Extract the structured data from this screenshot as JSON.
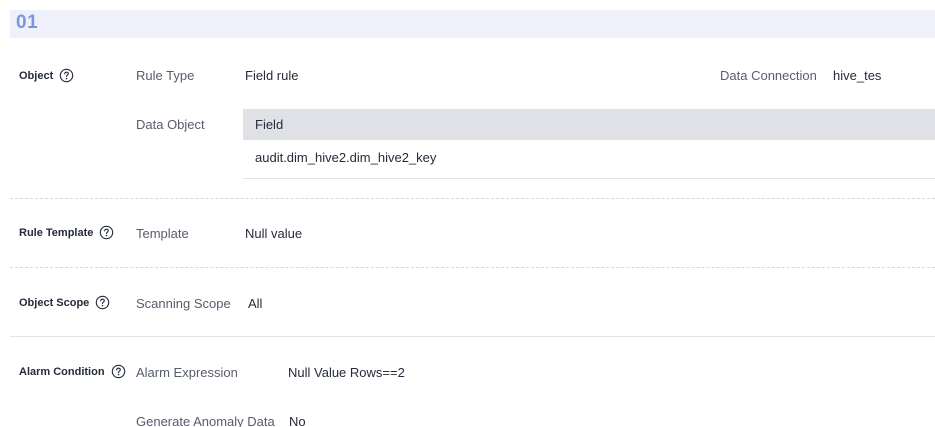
{
  "section": {
    "number": "01"
  },
  "object": {
    "label": "Object",
    "rule_type_label": "Rule Type",
    "rule_type_value": "Field rule",
    "data_connection_label": "Data Connection",
    "data_connection_value": "hive_tes",
    "data_object_label": "Data Object",
    "table": {
      "header": "Field",
      "rows": [
        "audit.dim_hive2.dim_hive2_key"
      ]
    }
  },
  "rule_template": {
    "label": "Rule Template",
    "template_label": "Template",
    "template_value": "Null value"
  },
  "object_scope": {
    "label": "Object Scope",
    "scanning_scope_label": "Scanning Scope",
    "scanning_scope_value": "All"
  },
  "alarm_condition": {
    "label": "Alarm Condition",
    "alarm_expression_label": "Alarm Expression",
    "alarm_expression_value": "Null Value Rows==2",
    "generate_anomaly_label": "Generate Anomaly Data",
    "generate_anomaly_value": "No"
  },
  "icons": {
    "help": "help-circle-icon"
  },
  "colors": {
    "banner_bg": "#eef1fb",
    "banner_text": "#7d96d9",
    "table_header_bg": "#dfe1e6"
  }
}
